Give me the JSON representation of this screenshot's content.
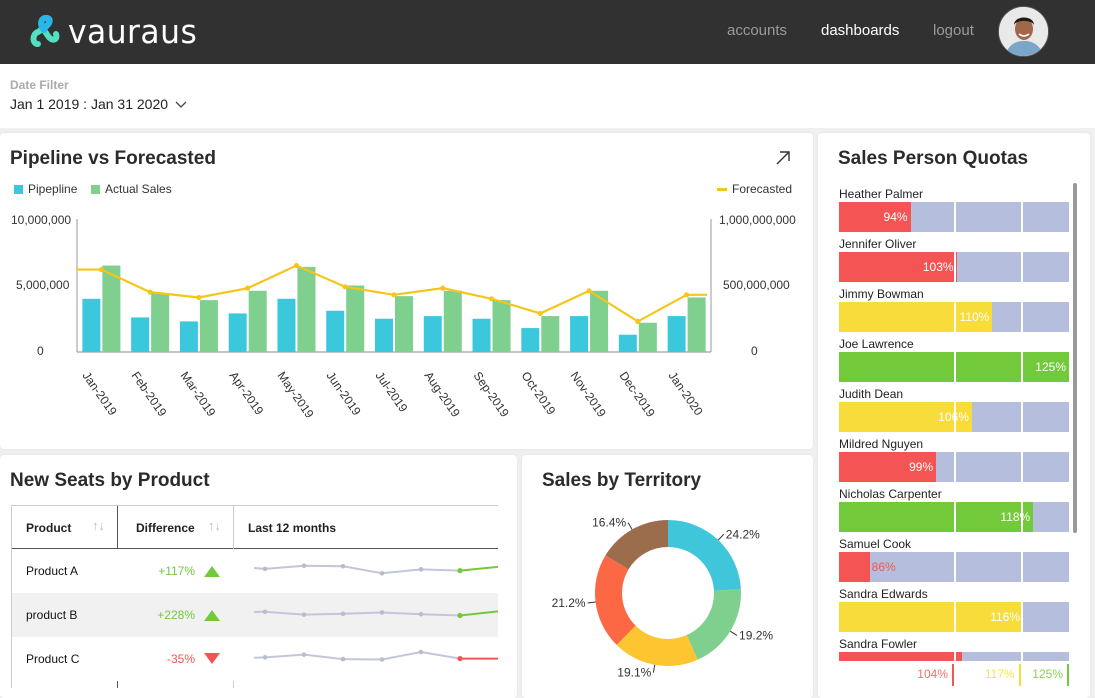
{
  "header": {
    "brand": "vauraus",
    "nav": [
      {
        "label": "accounts",
        "active": false
      },
      {
        "label": "dashboards",
        "active": true
      },
      {
        "label": "logout",
        "active": false
      }
    ]
  },
  "filter": {
    "label": "Date Filter",
    "value": "Jan 1 2019 : Jan 31 2020"
  },
  "pipeline": {
    "title": "Pipeline vs Forecasted",
    "legend_left": [
      "Pipepline",
      "Actual Sales"
    ],
    "legend_right": "Forecasted",
    "y_left_ticks": [
      "10,000,000",
      "5,000,000",
      "0"
    ],
    "y_right_ticks": [
      "1,000,000,000",
      "500,000,000",
      "0"
    ]
  },
  "colors": {
    "pipeline": "#3cc8dc",
    "actual": "#7fcf8e",
    "forecast": "#f5c518",
    "red": "#f55454",
    "yellow": "#f7dc3a",
    "green": "#72c93a",
    "track": "#b6bedd",
    "donut": [
      "#3fc6db",
      "#7fd08e",
      "#fdc52f",
      "#fb6843",
      "#9c6d4d"
    ]
  },
  "chart_data": [
    {
      "type": "bar",
      "title": "Pipeline vs Forecasted",
      "categories": [
        "Jan-2019",
        "Feb-2019",
        "Mar-2019",
        "Apr-2019",
        "May-2019",
        "Jun-2019",
        "Jul-2019",
        "Aug-2019",
        "Sep-2019",
        "Oct-2019",
        "Nov-2019",
        "Dec-2019",
        "Jan-2020"
      ],
      "series": [
        {
          "name": "Pipepline",
          "type": "bar",
          "axis": "left",
          "values": [
            4000000,
            2600000,
            2300000,
            2900000,
            4000000,
            3100000,
            2500000,
            2700000,
            2500000,
            1800000,
            2700000,
            1300000,
            2700000
          ]
        },
        {
          "name": "Actual Sales",
          "type": "bar",
          "axis": "left",
          "values": [
            6500000,
            4400000,
            3900000,
            4600000,
            6400000,
            5000000,
            4200000,
            4600000,
            3900000,
            2700000,
            4600000,
            2200000,
            4100000
          ]
        },
        {
          "name": "Forecasted",
          "type": "line",
          "axis": "right",
          "values": [
            620000000,
            450000000,
            410000000,
            480000000,
            650000000,
            490000000,
            430000000,
            480000000,
            400000000,
            290000000,
            460000000,
            230000000,
            430000000
          ]
        }
      ],
      "ylim_left": [
        0,
        10000000
      ],
      "ylim_right": [
        0,
        1000000000
      ],
      "legend": "top"
    },
    {
      "type": "pie",
      "title": "Sales by Territory",
      "donut": true,
      "labels": [
        "24.2%",
        "19.2%",
        "19.1%",
        "21.2%",
        "16.4%"
      ],
      "values": [
        24.2,
        19.2,
        19.1,
        21.2,
        16.4
      ]
    },
    {
      "type": "line",
      "title": "Last 12 months",
      "series": [
        {
          "name": "Product A",
          "values": [
            5,
            4.6,
            6,
            5.8,
            2.6,
            4.4,
            3.8,
            5.6
          ],
          "trend": "up"
        },
        {
          "name": "product B",
          "values": [
            5,
            5.1,
            3.8,
            4.2,
            4.8,
            4.0,
            3.4,
            5.4
          ],
          "trend": "up"
        },
        {
          "name": "Product C",
          "values": [
            4.2,
            4.4,
            5.6,
            3.6,
            3.4,
            6.8,
            3.8,
            3.8
          ],
          "trend": "down"
        }
      ]
    }
  ],
  "seats": {
    "title": "New Seats by Product",
    "columns": [
      "Product",
      "Difference",
      "Last 12 months"
    ],
    "rows": [
      {
        "product": "Product A",
        "difference": "+117%",
        "direction": "up"
      },
      {
        "product": "product B",
        "difference": "+228%",
        "direction": "up"
      },
      {
        "product": "Product C",
        "difference": "-35%",
        "direction": "down"
      }
    ]
  },
  "territory": {
    "title": "Sales by Territory"
  },
  "quotas": {
    "title": "Sales Person Quotas",
    "scale_min": 80,
    "scale_max": 125,
    "bands": [
      104,
      117,
      125
    ],
    "band_labels": [
      "104%",
      "117%",
      "125%"
    ],
    "people": [
      {
        "name": "Heather Palmer",
        "pct": 94,
        "label": "94%",
        "status": "red"
      },
      {
        "name": "Jennifer Oliver",
        "pct": 103,
        "label": "103%",
        "status": "red"
      },
      {
        "name": "Jimmy Bowman",
        "pct": 110,
        "label": "110%",
        "status": "yellow"
      },
      {
        "name": "Joe Lawrence",
        "pct": 125,
        "label": "125%",
        "status": "green"
      },
      {
        "name": "Judith Dean",
        "pct": 106,
        "label": "106%",
        "status": "yellow"
      },
      {
        "name": "Mildred Nguyen",
        "pct": 99,
        "label": "99%",
        "status": "red"
      },
      {
        "name": "Nicholas Carpenter",
        "pct": 118,
        "label": "118%",
        "status": "green"
      },
      {
        "name": "Samuel Cook",
        "pct": 86,
        "label": "86%",
        "status": "red"
      },
      {
        "name": "Sandra Edwards",
        "pct": 116,
        "label": "116%",
        "status": "yellow"
      },
      {
        "name": "Sandra Fowler",
        "pct": 104,
        "label": "104%",
        "status": "red"
      }
    ]
  }
}
